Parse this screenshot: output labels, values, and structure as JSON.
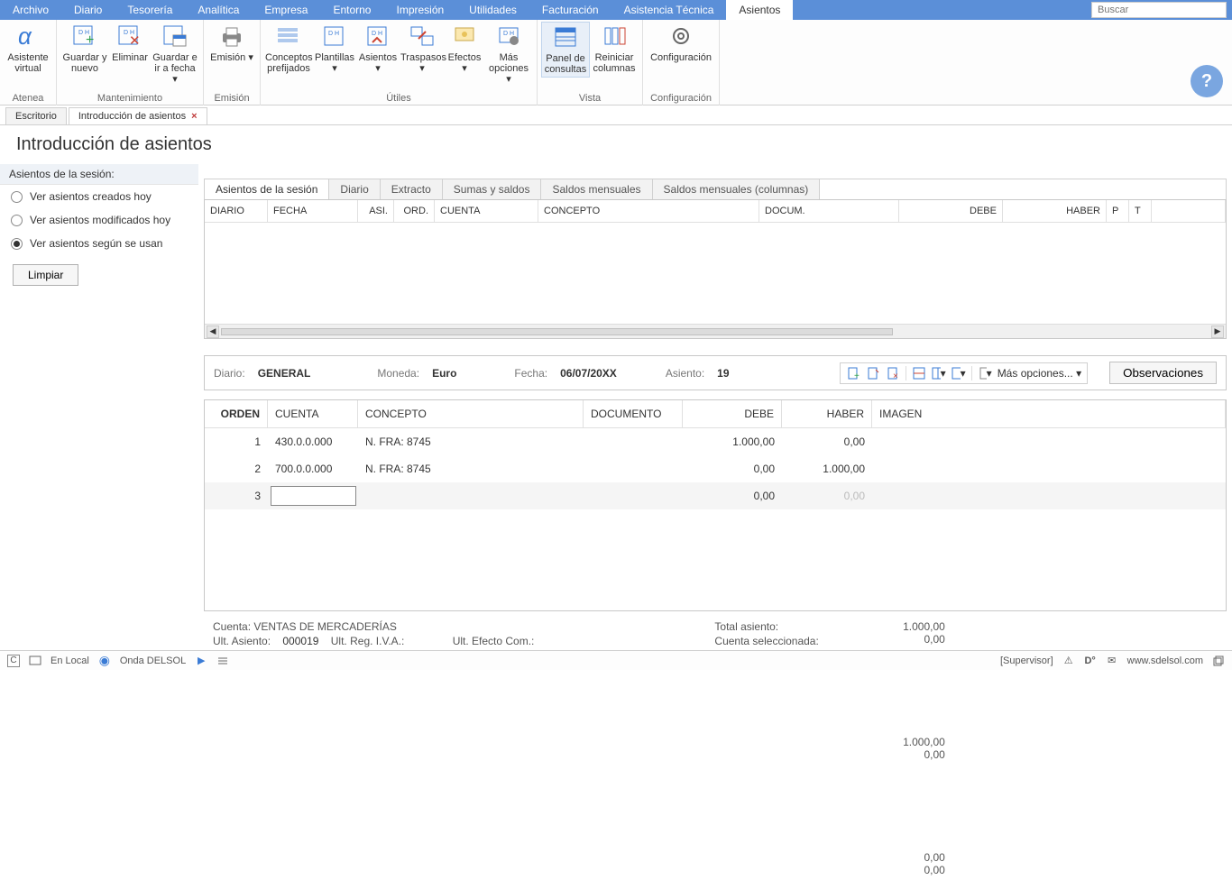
{
  "menu": {
    "items": [
      "Archivo",
      "Diario",
      "Tesorería",
      "Analítica",
      "Empresa",
      "Entorno",
      "Impresión",
      "Utilidades",
      "Facturación",
      "Asistencia Técnica",
      "Asientos"
    ],
    "active_index": 10,
    "search_placeholder": "Buscar"
  },
  "ribbon": {
    "groups": [
      {
        "label": "Atenea",
        "buttons": [
          {
            "name": "asistente-virtual",
            "label": "Asistente virtual"
          }
        ]
      },
      {
        "label": "Mantenimiento",
        "buttons": [
          {
            "name": "guardar-y-nuevo",
            "label": "Guardar y nuevo"
          },
          {
            "name": "eliminar",
            "label": "Eliminar"
          },
          {
            "name": "guardar-e-ir-a-fecha",
            "label": "Guardar e ir a fecha ▾"
          }
        ]
      },
      {
        "label": "Emisión",
        "buttons": [
          {
            "name": "emision",
            "label": "Emisión ▾"
          }
        ]
      },
      {
        "label": "Útiles",
        "buttons": [
          {
            "name": "conceptos-prefijados",
            "label": "Conceptos prefijados"
          },
          {
            "name": "plantillas",
            "label": "Plantillas ▾"
          },
          {
            "name": "asientos",
            "label": "Asientos ▾"
          },
          {
            "name": "traspasos",
            "label": "Traspasos ▾"
          },
          {
            "name": "efectos",
            "label": "Efectos ▾"
          },
          {
            "name": "mas-opciones",
            "label": "Más opciones ▾"
          }
        ]
      },
      {
        "label": "Vista",
        "buttons": [
          {
            "name": "panel-de-consultas",
            "label": "Panel de consultas",
            "active": true
          },
          {
            "name": "reiniciar-columnas",
            "label": "Reiniciar columnas"
          }
        ]
      },
      {
        "label": "Configuración",
        "buttons": [
          {
            "name": "configuracion",
            "label": "Configuración"
          }
        ]
      }
    ]
  },
  "doctabs": [
    {
      "label": "Escritorio",
      "closable": false
    },
    {
      "label": "Introducción de asientos",
      "closable": true,
      "active": true
    }
  ],
  "page_title": "Introducción de asientos",
  "side": {
    "header": "Asientos de la sesión:",
    "radios": [
      {
        "label": "Ver asientos creados hoy",
        "checked": false
      },
      {
        "label": "Ver asientos modificados hoy",
        "checked": false
      },
      {
        "label": "Ver asientos según se usan",
        "checked": true
      }
    ],
    "clear_button": "Limpiar"
  },
  "inner_tabs": [
    "Asientos de la sesión",
    "Diario",
    "Extracto",
    "Sumas y saldos",
    "Saldos mensuales",
    "Saldos mensuales (columnas)"
  ],
  "upper_grid_cols": [
    "DIARIO",
    "FECHA",
    "ASI.",
    "ORD.",
    "CUENTA",
    "CONCEPTO",
    "DOCUM.",
    "DEBE",
    "HABER",
    "P",
    "T"
  ],
  "entry_bar": {
    "diario_label": "Diario:",
    "diario_value": "GENERAL",
    "moneda_label": "Moneda:",
    "moneda_value": "Euro",
    "fecha_label": "Fecha:",
    "fecha_value": "06/07/20XX",
    "asiento_label": "Asiento:",
    "asiento_value": "19",
    "more_options": "Más opciones... ▾",
    "observations_button": "Observaciones"
  },
  "lower_grid": {
    "cols": [
      "ORDEN",
      "CUENTA",
      "CONCEPTO",
      "DOCUMENTO",
      "DEBE",
      "HABER",
      "IMAGEN"
    ],
    "rows": [
      {
        "orden": "1",
        "cuenta": "430.0.0.000",
        "concepto": "N. FRA:  8745",
        "documento": "",
        "debe": "1.000,00",
        "haber": "0,00"
      },
      {
        "orden": "2",
        "cuenta": "700.0.0.000",
        "concepto": "N. FRA:  8745",
        "documento": "",
        "debe": "0,00",
        "haber": "1.000,00"
      },
      {
        "orden": "3",
        "cuenta": "",
        "concepto": "",
        "documento": "",
        "debe": "0,00",
        "haber": "0,00",
        "editing": true
      }
    ]
  },
  "footer": {
    "cuenta_label": "Cuenta:",
    "cuenta_value": "VENTAS DE MERCADERÍAS",
    "ult_asiento_label": "Ult. Asiento:",
    "ult_asiento_value": "000019",
    "ult_reg_iva": "Ult. Reg. I.V.A.:",
    "ult_efecto": "Ult. Efecto Com.:",
    "total_asiento_label": "Total asiento:",
    "cuenta_sel_label": "Cuenta seleccionada:",
    "total_debe": "1.000,00",
    "total_haber": "1.000,00",
    "total_diff": "0,00",
    "sel_debe": "0,00",
    "sel_haber": "0,00",
    "sel_diff": "0,00"
  },
  "statusbar": {
    "c_label": "C",
    "local": "En Local",
    "onda": "Onda DELSOL",
    "supervisor": "[Supervisor]",
    "web": "www.sdelsol.com"
  }
}
